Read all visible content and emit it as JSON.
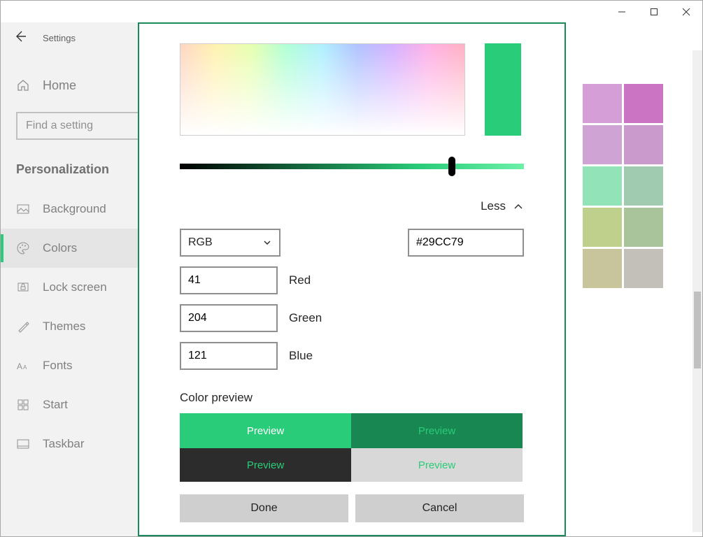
{
  "titlebar": {
    "minimize": "—",
    "maximize": "☐",
    "close": "✕"
  },
  "sidebar": {
    "title": "Settings",
    "home_label": "Home",
    "search_placeholder": "Find a setting",
    "section": "Personalization",
    "items": [
      {
        "label": "Background"
      },
      {
        "label": "Colors",
        "active": true
      },
      {
        "label": "Lock screen"
      },
      {
        "label": "Themes"
      },
      {
        "label": "Fonts"
      },
      {
        "label": "Start"
      },
      {
        "label": "Taskbar"
      }
    ]
  },
  "dialog": {
    "less_label": "Less",
    "color_mode": "RGB",
    "hex": "#29CC79",
    "channels": {
      "r": "41",
      "g": "204",
      "b": "121"
    },
    "channel_labels": {
      "r": "Red",
      "g": "Green",
      "b": "Blue"
    },
    "preview_title": "Color preview",
    "preview_label": "Preview",
    "done": "Done",
    "cancel": "Cancel",
    "accent": "#29CC79",
    "slider_position_pct": 78
  },
  "swatches": [
    "#d69ed6",
    "#ca74c3",
    "#d0a3d5",
    "#ca9acc",
    "#93e3b8",
    "#a0cbb0",
    "#bfd08c",
    "#a9c49a",
    "#c8c59d",
    "#c3c0b9"
  ]
}
